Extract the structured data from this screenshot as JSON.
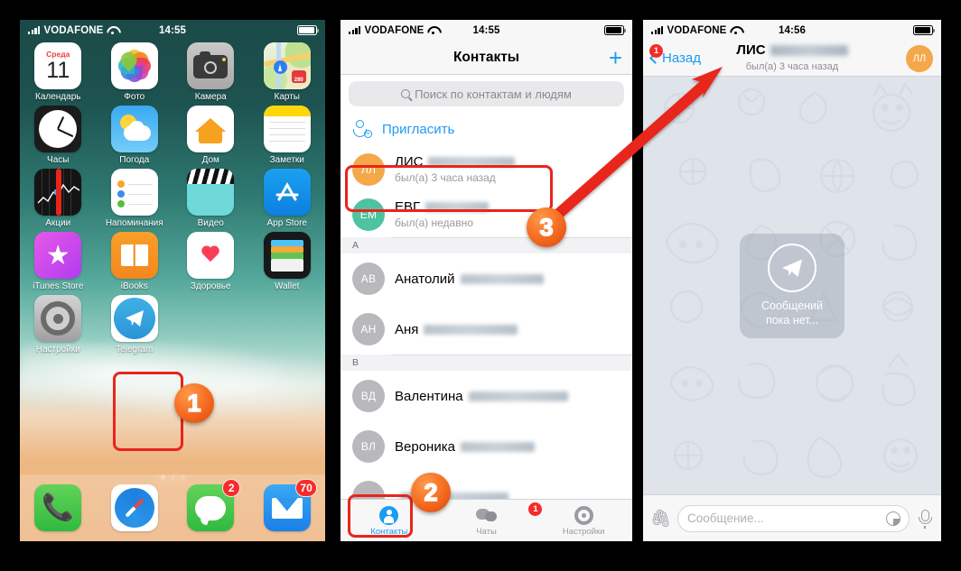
{
  "panels": {
    "home": {
      "status": {
        "carrier": "VODAFONE",
        "time": "14:55"
      },
      "apps": [
        [
          {
            "label": "Календарь",
            "icon": "calendar-icon",
            "day_name": "Среда",
            "day_num": "11"
          },
          {
            "label": "Фото",
            "icon": "photos-icon"
          },
          {
            "label": "Камера",
            "icon": "camera-icon"
          },
          {
            "label": "Карты",
            "icon": "maps-icon",
            "shield": "280"
          }
        ],
        [
          {
            "label": "Часы",
            "icon": "clock-icon"
          },
          {
            "label": "Погода",
            "icon": "weather-icon"
          },
          {
            "label": "Дом",
            "icon": "home-icon"
          },
          {
            "label": "Заметки",
            "icon": "notes-icon"
          }
        ],
        [
          {
            "label": "Акции",
            "icon": "stocks-icon"
          },
          {
            "label": "Напоминания",
            "icon": "reminders-icon"
          },
          {
            "label": "Видео",
            "icon": "videos-icon"
          },
          {
            "label": "App Store",
            "icon": "appstore-icon"
          }
        ],
        [
          {
            "label": "iTunes Store",
            "icon": "itunes-icon"
          },
          {
            "label": "iBooks",
            "icon": "ibooks-icon"
          },
          {
            "label": "Здоровье",
            "icon": "health-icon"
          },
          {
            "label": "Wallet",
            "icon": "wallet-icon"
          }
        ],
        [
          {
            "label": "Настройки",
            "icon": "settings-icon"
          },
          {
            "label": "Telegram",
            "icon": "telegram-icon"
          }
        ]
      ],
      "dock": [
        {
          "label": "Телефон",
          "icon": "phone-icon",
          "badge": ""
        },
        {
          "label": "Safari",
          "icon": "safari-icon",
          "badge": ""
        },
        {
          "label": "Сообщения",
          "icon": "messages-icon",
          "badge": "2"
        },
        {
          "label": "Почта",
          "icon": "mail-icon",
          "badge": "70"
        }
      ],
      "page_dots": 3,
      "active_dot": 1
    },
    "contacts": {
      "status": {
        "carrier": "VODAFONE",
        "time": "14:55"
      },
      "nav": {
        "title": "Контакты",
        "add_label": "+"
      },
      "search": {
        "placeholder": "Поиск по контактам и людям"
      },
      "invite_label": "Пригласить",
      "rows": [
        {
          "initials": "ЛЛ",
          "name": "ЛИС",
          "blur_w": 96,
          "sub": "был(а) 3 часа назад",
          "color": "#f4a84a",
          "highlight": true
        },
        {
          "initials": "ЕМ",
          "name": "ЕВГ",
          "blur_w": 70,
          "sub": "был(а) недавно",
          "color": "#4fc3a1",
          "highlight": false
        }
      ],
      "sections": [
        {
          "letter": "А",
          "rows": [
            {
              "initials": "АВ",
              "name": "Анатолий",
              "blur_w": 92,
              "sub": "",
              "color": "#b8b8bd"
            },
            {
              "initials": "АН",
              "name": "Аня",
              "blur_w": 104,
              "sub": "",
              "color": "#b8b8bd"
            }
          ]
        },
        {
          "letter": "В",
          "rows": [
            {
              "initials": "ВД",
              "name": "Валентина",
              "blur_w": 110,
              "sub": "",
              "color": "#b8b8bd"
            },
            {
              "initials": "ВЛ",
              "name": "Вероника",
              "blur_w": 82,
              "sub": "",
              "color": "#b8b8bd"
            }
          ]
        }
      ],
      "tabs": [
        {
          "label": "Контакты",
          "icon": "person-icon",
          "active": true,
          "badge": ""
        },
        {
          "label": "Чаты",
          "icon": "chat-bubbles-icon",
          "active": false,
          "badge": "1"
        },
        {
          "label": "Настройки",
          "icon": "gear-icon",
          "active": false,
          "badge": ""
        }
      ]
    },
    "chat": {
      "status": {
        "carrier": "VODAFONE",
        "time": "14:56"
      },
      "back_label": "Назад",
      "back_badge": "1",
      "title": "ЛИС",
      "subtitle": "был(а) 3 часа назад",
      "avatar_initials": "ЛЛ",
      "empty_line1": "Сообщений",
      "empty_line2": "пока нет...",
      "input": {
        "placeholder": "Сообщение...",
        "attach_icon": "paperclip-icon",
        "sticker_icon": "sticker-icon",
        "mic_icon": "microphone-icon"
      }
    }
  },
  "annotations": {
    "steps": [
      {
        "id": "1",
        "label": "1"
      },
      {
        "id": "2",
        "label": "2"
      },
      {
        "id": "3",
        "label": "3"
      }
    ],
    "accent_color": "#e8251c",
    "step_color": "#f4691f"
  }
}
